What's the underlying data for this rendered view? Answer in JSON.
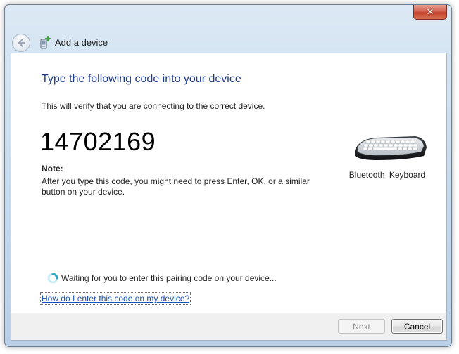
{
  "titlebar": {
    "close_label": "✕"
  },
  "nav": {
    "title": "Add a device"
  },
  "main": {
    "heading": "Type the following code into your device",
    "subtext": "This will verify that you are connecting to the correct device.",
    "pairing_code": "14702169",
    "note_label": "Note:",
    "note_text": "After you type this code, you might need to press Enter, OK, or a similar button on your device.",
    "device_label": "Bluetooth  Keyboard",
    "status_text": "Waiting for you to enter this pairing code on your device...",
    "help_link": "How do I enter this code on my device?"
  },
  "footer": {
    "next_label": "Next",
    "cancel_label": "Cancel"
  },
  "colors": {
    "heading": "#1c3a8e",
    "link": "#1a4fb3",
    "close_button": "#c2402b"
  },
  "icons": {
    "back": "back-arrow-icon",
    "add_device": "add-device-icon",
    "keyboard": "keyboard-icon",
    "spinner": "busy-spinner-icon"
  }
}
